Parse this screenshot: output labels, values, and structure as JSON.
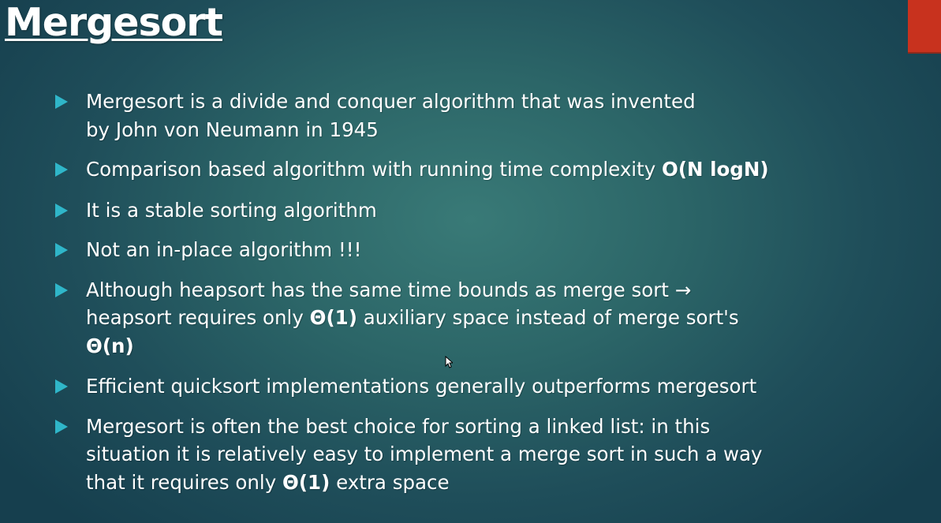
{
  "slide": {
    "title": "Mergesort",
    "accent_color": "#c8321e",
    "bullet_marker_color": "#2fb6c9",
    "bullets": [
      {
        "line1": "Mergesort is a divide and conquer algorithm that was invented",
        "line2": "by John von Neumann in 1945"
      },
      {
        "text": "Comparison based algorithm with running time complexity ",
        "bold": "O(N logN)"
      },
      {
        "text": "It is a stable sorting algorithm"
      },
      {
        "text": "Not an in-place algorithm !!!"
      },
      {
        "line1": "Although heapsort has the same time bounds as merge sort →",
        "line2_pre": "heapsort requires only ",
        "line2_bold": "Θ(1)",
        "line2_post": " auxiliary space instead of merge sort's",
        "line3_bold": "Θ(n)"
      },
      {
        "text": "Efficient quicksort implementations generally outperforms mergesort"
      },
      {
        "line1": "Mergesort is often the best choice for sorting a linked list: in this",
        "line2": "situation it is relatively easy to implement a merge sort in such a way",
        "line3_pre": "that it requires only ",
        "line3_bold": "Θ(1)",
        "line3_post": " extra space"
      }
    ]
  },
  "icons": {
    "bullet": "triangle-right-icon",
    "cursor": "mouse-pointer-icon"
  }
}
